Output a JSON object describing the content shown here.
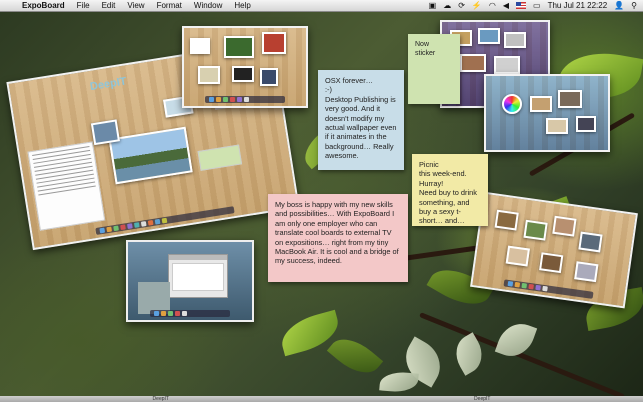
{
  "menubar": {
    "apple_glyph": "",
    "app_name": "ExpoBoard",
    "menus": [
      "File",
      "Edit",
      "View",
      "Format",
      "Window",
      "Help"
    ],
    "clock": "Thu Jul 21  22:22",
    "icons": [
      "dropbox-icon",
      "wifi-icon",
      "volume-icon",
      "flag-icon",
      "battery-icon",
      "user-icon",
      "spotlight-icon"
    ]
  },
  "notes": {
    "osx": "OSX forever…\n:-)\nDesktop Publishing is very good. And it doesn't modify my actual wallpaper even if it animates in the background… Really awesome.",
    "boss": "My boss is happy with my new skills and possibilities… With ExpoBoard I am only one employer who can translate cool boards to external TV on expositions… right from my tiny MacBook Air. It is cool and a bridge of my success, indeed.",
    "picnic": "Picnic\nthis week-end.\nHurray!\nNeed buy to drink something, and buy a sexy t-short… and…",
    "green_partial": "Now\nsticker"
  },
  "board_label": "DeepIT",
  "bottom_labels": [
    "DeepIT",
    "DeepIT"
  ],
  "colors": {
    "note_blue": "#c8dde8",
    "note_pink": "#f3c8c8",
    "note_yellow": "#f2eaa6",
    "note_green": "#cfe3b0"
  }
}
